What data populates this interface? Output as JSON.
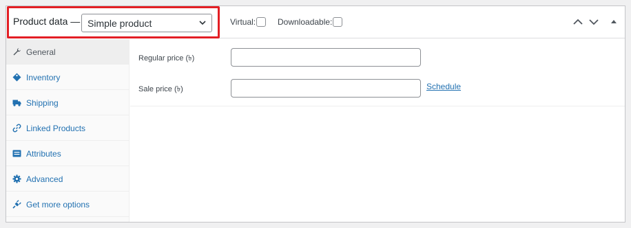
{
  "header": {
    "product_data_label": "Product data —",
    "product_type": {
      "selected": "Simple product"
    },
    "virtual_label": "Virtual:",
    "virtual_checked": false,
    "downloadable_label": "Downloadable:",
    "downloadable_checked": false,
    "buttons": [
      "move-up-icon",
      "move-down-icon",
      "toggle-panel-icon"
    ]
  },
  "sidebar": {
    "items": [
      {
        "label": "General",
        "icon": "wrench-icon",
        "active": true
      },
      {
        "label": "Inventory",
        "icon": "tag-icon",
        "active": false
      },
      {
        "label": "Shipping",
        "icon": "truck-icon",
        "active": false
      },
      {
        "label": "Linked Products",
        "icon": "link-icon",
        "active": false
      },
      {
        "label": "Attributes",
        "icon": "list-icon",
        "active": false
      },
      {
        "label": "Advanced",
        "icon": "gear-icon",
        "active": false
      },
      {
        "label": "Get more options",
        "icon": "plugin-icon",
        "active": false
      }
    ]
  },
  "general": {
    "regular_price_label": "Regular price (৳)",
    "regular_price_value": "",
    "sale_price_label": "Sale price (৳)",
    "sale_price_value": "",
    "schedule_link": "Schedule"
  },
  "colors": {
    "accent": "#2271b1",
    "highlight_border": "#e31e24",
    "active_tab_bg": "#eeeeee"
  }
}
